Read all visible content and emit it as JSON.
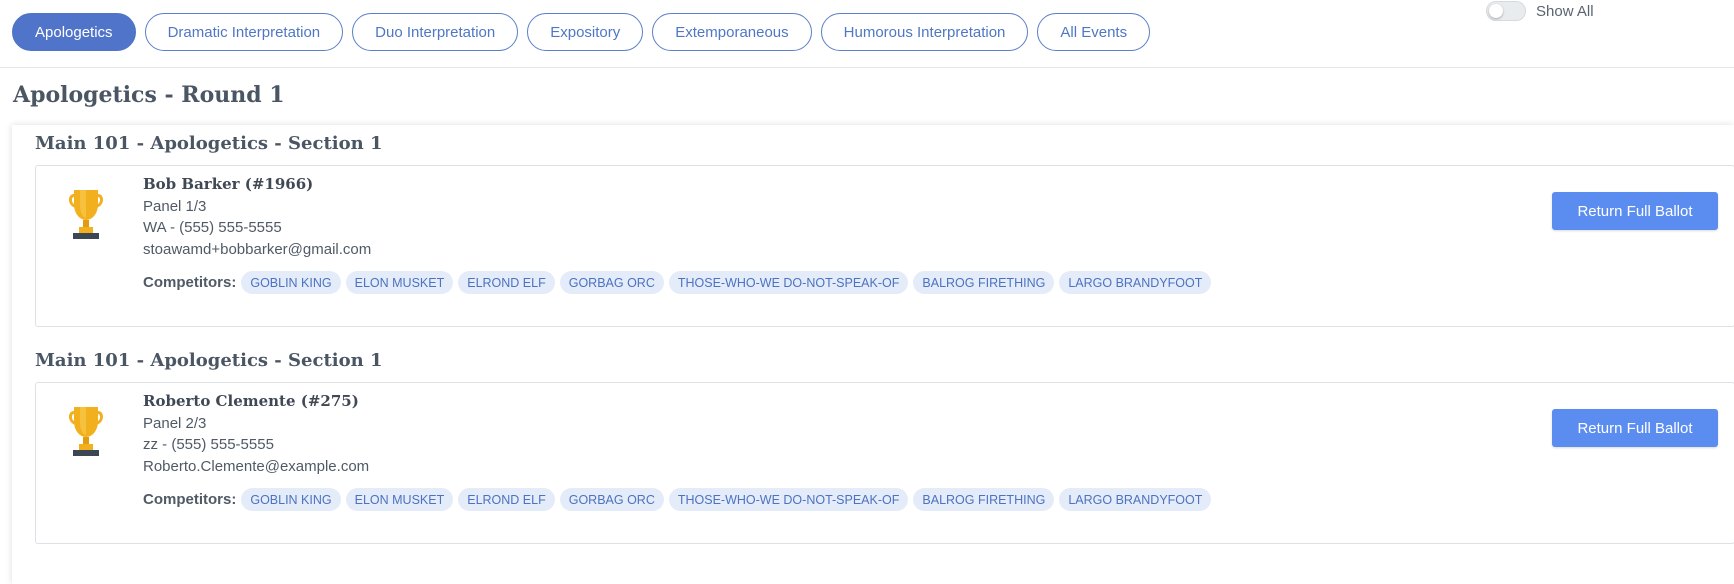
{
  "tabs": [
    {
      "label": "Apologetics",
      "active": true
    },
    {
      "label": "Dramatic Interpretation",
      "active": false
    },
    {
      "label": "Duo Interpretation",
      "active": false
    },
    {
      "label": "Expository",
      "active": false
    },
    {
      "label": "Extemporaneous",
      "active": false
    },
    {
      "label": "Humorous Interpretation",
      "active": false
    },
    {
      "label": "All Events",
      "active": false
    }
  ],
  "show_all": {
    "label": "Show All",
    "checked": false
  },
  "round_title": "Apologetics - Round 1",
  "sections": [
    {
      "title": "Main 101 - Apologetics - Section 1",
      "judge": {
        "name": "Bob Barker (#1966)",
        "panel": "Panel 1/3",
        "phone": "WA - (555) 555-5555",
        "email": "stoawamd+bobbarker@gmail.com"
      },
      "competitors_label": "Competitors:",
      "competitors": [
        "GOBLIN KING",
        "ELON MUSKET",
        "ELROND ELF",
        "GORBAG ORC",
        "THOSE-WHO-WE DO-NOT-SPEAK-OF",
        "BALROG FIRETHING",
        "LARGO BRANDYFOOT"
      ],
      "button_label": "Return Full Ballot"
    },
    {
      "title": "Main 101 - Apologetics - Section 1",
      "judge": {
        "name": "Roberto Clemente (#275)",
        "panel": "Panel 2/3",
        "phone": "zz - (555) 555-5555",
        "email": "Roberto.Clemente@example.com"
      },
      "competitors_label": "Competitors:",
      "competitors": [
        "GOBLIN KING",
        "ELON MUSKET",
        "ELROND ELF",
        "GORBAG ORC",
        "THOSE-WHO-WE DO-NOT-SPEAK-OF",
        "BALROG FIRETHING",
        "LARGO BRANDYFOOT"
      ],
      "button_label": "Return Full Ballot"
    }
  ],
  "colors": {
    "accent": "#4f74c9",
    "button": "#5b8df0",
    "chip_bg": "#e4ecfa",
    "trophy": "#f2b01e"
  }
}
